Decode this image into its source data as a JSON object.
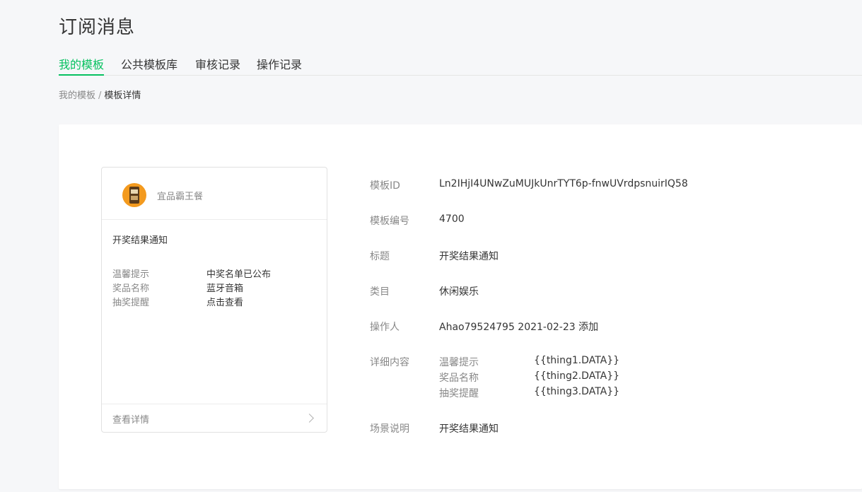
{
  "page": {
    "title": "订阅消息"
  },
  "tabs": [
    {
      "label": "我的模板",
      "active": true
    },
    {
      "label": "公共模板库",
      "active": false
    },
    {
      "label": "审核记录",
      "active": false
    },
    {
      "label": "操作记录",
      "active": false
    }
  ],
  "breadcrumb": {
    "parent": "我的模板",
    "separator": "/",
    "current": "模板详情"
  },
  "preview": {
    "shop_name": "宜品霸王餐",
    "title": "开奖结果通知",
    "rows": [
      {
        "key": "温馨提示",
        "value": "中奖名单已公布"
      },
      {
        "key": "奖品名称",
        "value": "蓝牙音箱"
      },
      {
        "key": "抽奖提醒",
        "value": "点击查看"
      }
    ],
    "footer": "查看详情"
  },
  "details": {
    "template_id": {
      "label": "模板ID",
      "value": "Ln2IHjI4UNwZuMUJkUnrTYT6p-fnwUVrdpsnuirIQ58"
    },
    "template_no": {
      "label": "模板编号",
      "value": "4700"
    },
    "title": {
      "label": "标题",
      "value": "开奖结果通知"
    },
    "category": {
      "label": "类目",
      "value": "休闲娱乐"
    },
    "operator": {
      "label": "操作人",
      "value": "Ahao79524795 2021-02-23 添加"
    },
    "content": {
      "label": "详细内容",
      "rows": [
        {
          "key": "温馨提示",
          "value": "{{thing1.DATA}}"
        },
        {
          "key": "奖品名称",
          "value": "{{thing2.DATA}}"
        },
        {
          "key": "抽奖提醒",
          "value": "{{thing3.DATA}}"
        }
      ]
    },
    "scene": {
      "label": "场景说明",
      "value": "开奖结果通知"
    }
  },
  "colors": {
    "accent": "#07c160",
    "background": "#f6f7f9"
  }
}
